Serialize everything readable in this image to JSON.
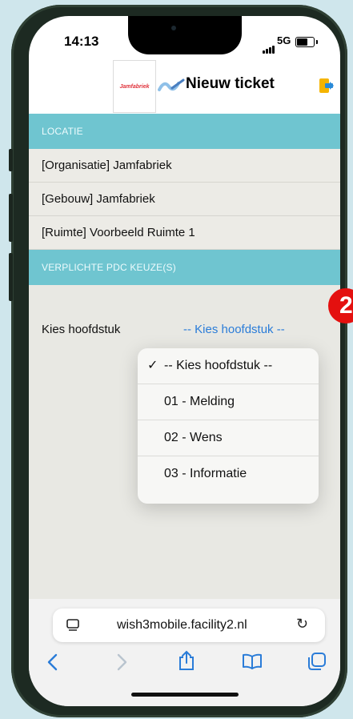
{
  "status_bar": {
    "time": "14:13",
    "network": "5G"
  },
  "header": {
    "logo_text": "Jamfabriek",
    "title": "Nieuw ticket"
  },
  "sections": {
    "location": "LOCATIE",
    "required": "VERPLICHTE PDC KEUZE(S)"
  },
  "location_rows": [
    "[Organisatie] Jamfabriek",
    "[Gebouw] Jamfabriek",
    "[Ruimte] Voorbeeld Ruimte 1"
  ],
  "chapter": {
    "label": "Kies hoofdstuk",
    "selected": "-- Kies hoofdstuk --"
  },
  "dropdown": {
    "options": [
      "-- Kies hoofdstuk --",
      "01 - Melding",
      "02 - Wens",
      "03 - Informatie"
    ],
    "check": "✓"
  },
  "browser": {
    "url": "wish3mobile.facility2.nl",
    "reload": "↻"
  },
  "badge": {
    "text": "2"
  },
  "colors": {
    "section_bg": "#6fc5d0",
    "link": "#2a7cd8",
    "badge": "#e4100f"
  }
}
